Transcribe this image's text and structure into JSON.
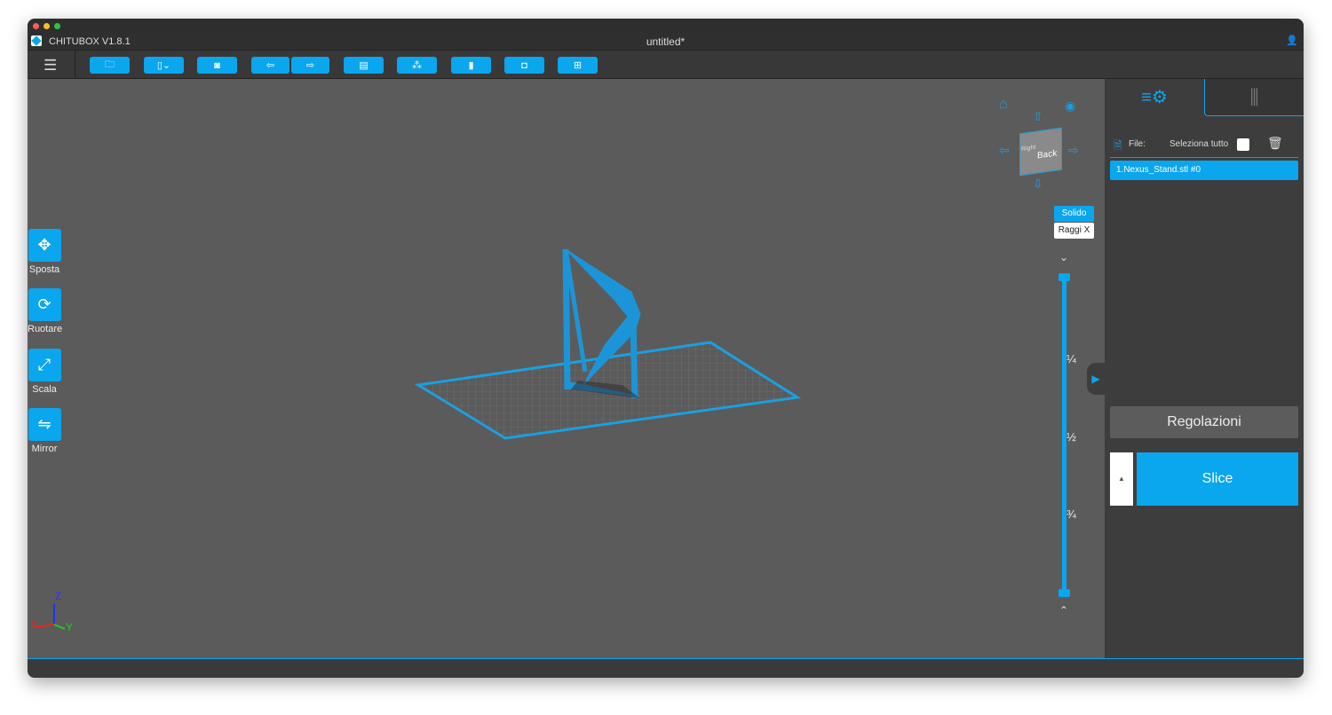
{
  "window": {
    "app_name": "CHITUBOX V1.8.1",
    "doc_title": "untitled*"
  },
  "toolbar": {
    "buttons": [
      "open-file",
      "save",
      "screenshot",
      "import",
      "export",
      "copy",
      "arrange",
      "support",
      "hollow",
      "dig-hole"
    ]
  },
  "tools": [
    {
      "label": "Sposta",
      "icon": "✥"
    },
    {
      "label": "Ruotare",
      "icon": "⟳"
    },
    {
      "label": "Scala",
      "icon": "⤢"
    },
    {
      "label": "Mirror",
      "icon": "⇋"
    }
  ],
  "viewcube": {
    "face": "Back",
    "side": "Right"
  },
  "render_modes": {
    "solid": "Solido",
    "xray": "Raggi X"
  },
  "slider": {
    "marks": [
      "¼",
      "½",
      "¾"
    ]
  },
  "axes": {
    "x": "X",
    "y": "Y",
    "z": "Z"
  },
  "panel": {
    "file_label": "File:",
    "select_all": "Seleziona tutto",
    "files": [
      "1.Nexus_Stand.stl #0"
    ],
    "adjust": "Regolazioni",
    "slice": "Slice"
  },
  "colors": {
    "accent": "#0aa6ee"
  }
}
